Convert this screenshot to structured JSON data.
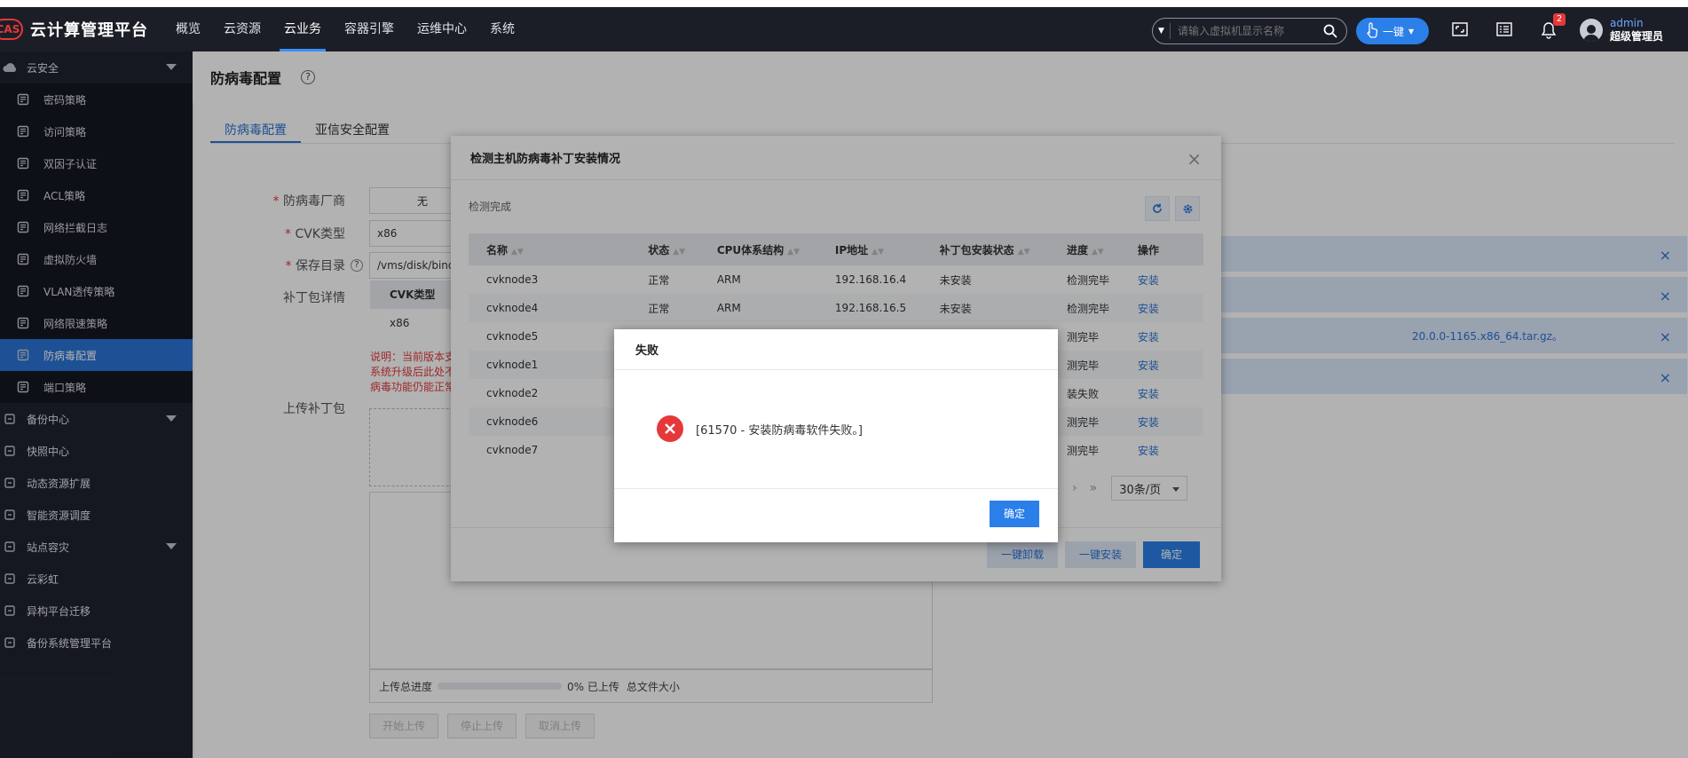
{
  "header": {
    "badge": "CAS",
    "title": "云计算管理平台",
    "nav": [
      "概览",
      "云资源",
      "云业务",
      "容器引擎",
      "运维中心",
      "系统"
    ],
    "nav_active": 2,
    "search_placeholder": "请输入虚拟机显示名称",
    "one_click": "一键",
    "bell_count": "2",
    "user_name": "admin",
    "user_role": "超级管理员"
  },
  "sidebar": {
    "group_security": "云安全",
    "security_items": [
      "密码策略",
      "访问策略",
      "双因子认证",
      "ACL策略",
      "网络拦截日志",
      "虚拟防火墙",
      "VLAN透传策略",
      "网络限速策略",
      "防病毒配置",
      "端口策略"
    ],
    "active_index": 8,
    "other_groups": [
      {
        "label": "备份中心",
        "icon": "backup-icon",
        "arrow": true
      },
      {
        "label": "快照中心",
        "icon": "snapshot-icon",
        "arrow": false
      },
      {
        "label": "动态资源扩展",
        "icon": "drx-icon",
        "arrow": false
      },
      {
        "label": "智能资源调度",
        "icon": "schedule-icon",
        "arrow": false
      },
      {
        "label": "站点容灾",
        "icon": "disaster-icon",
        "arrow": true
      },
      {
        "label": "云彩虹",
        "icon": "rainbow-icon",
        "arrow": false
      },
      {
        "label": "异构平台迁移",
        "icon": "migrate-icon",
        "arrow": false
      },
      {
        "label": "备份系统管理平台",
        "icon": "backup-platform-icon",
        "arrow": false
      }
    ]
  },
  "page": {
    "title": "防病毒配置",
    "help": "?",
    "tabs": [
      "防病毒配置",
      "亚信安全配置"
    ],
    "form": {
      "vendor_label": "防病毒厂商",
      "vendor_value": "无",
      "cvk_label": "CVK类型",
      "cvk_value": "x86",
      "dir_label": "保存目录",
      "dir_value": "/vms/disk/bind",
      "patch_label": "补丁包详情",
      "patch_col": "CVK类型",
      "patch_val": "x86",
      "note_lines": [
        "说明：当前版本支",
        "系统升级后此处不",
        "病毒功能仍能正常"
      ],
      "upload_label": "上传补丁包",
      "upload_progress_label": "上传总进度",
      "upload_progress_value": "0% 已上传",
      "upload_size_label": "总文件大小",
      "btn_start": "开始上传",
      "btn_stop": "停止上传",
      "btn_cancel": "取消上传"
    },
    "alerts": [
      "",
      "",
      "20.0.0-1165.x86_64.tar.gz。",
      ""
    ],
    "alert_close": "×"
  },
  "dialog1": {
    "title": "检测主机防病毒补丁安装情况",
    "close": "×",
    "status": "检测完成",
    "columns": [
      "名称",
      "状态",
      "CPU体系结构",
      "IP地址",
      "补丁包安装状态",
      "进度",
      "操作"
    ],
    "rows": [
      [
        "cvknode3",
        "正常",
        "ARM",
        "192.168.16.4",
        "未安装",
        "检测完毕",
        "安装"
      ],
      [
        "cvknode4",
        "正常",
        "ARM",
        "192.168.16.5",
        "未安装",
        "检测完毕",
        "安装"
      ],
      [
        "cvknode5",
        "",
        "",
        "",
        "",
        "测完毕",
        "安装"
      ],
      [
        "cvknode1",
        "",
        "",
        "",
        "",
        "测完毕",
        "安装"
      ],
      [
        "cvknode2",
        "",
        "",
        "",
        "",
        "装失败",
        "安装"
      ],
      [
        "cvknode6",
        "",
        "",
        "",
        "",
        "测完毕",
        "安装"
      ],
      [
        "cvknode7",
        "",
        "",
        "",
        "",
        "测完毕",
        "安装"
      ]
    ],
    "page_size": "30条/页",
    "btn_uninstall": "一键卸载",
    "btn_install": "一键安装",
    "btn_ok": "确定"
  },
  "dialog2": {
    "title": "失败",
    "message": "[61570 - 安装防病毒软件失败。]",
    "ok": "确定"
  },
  "colors": {
    "accent": "#2b7fe8",
    "danger": "#e5383b",
    "topbar": "#1b1e27",
    "sidebar": "#1f2330"
  }
}
